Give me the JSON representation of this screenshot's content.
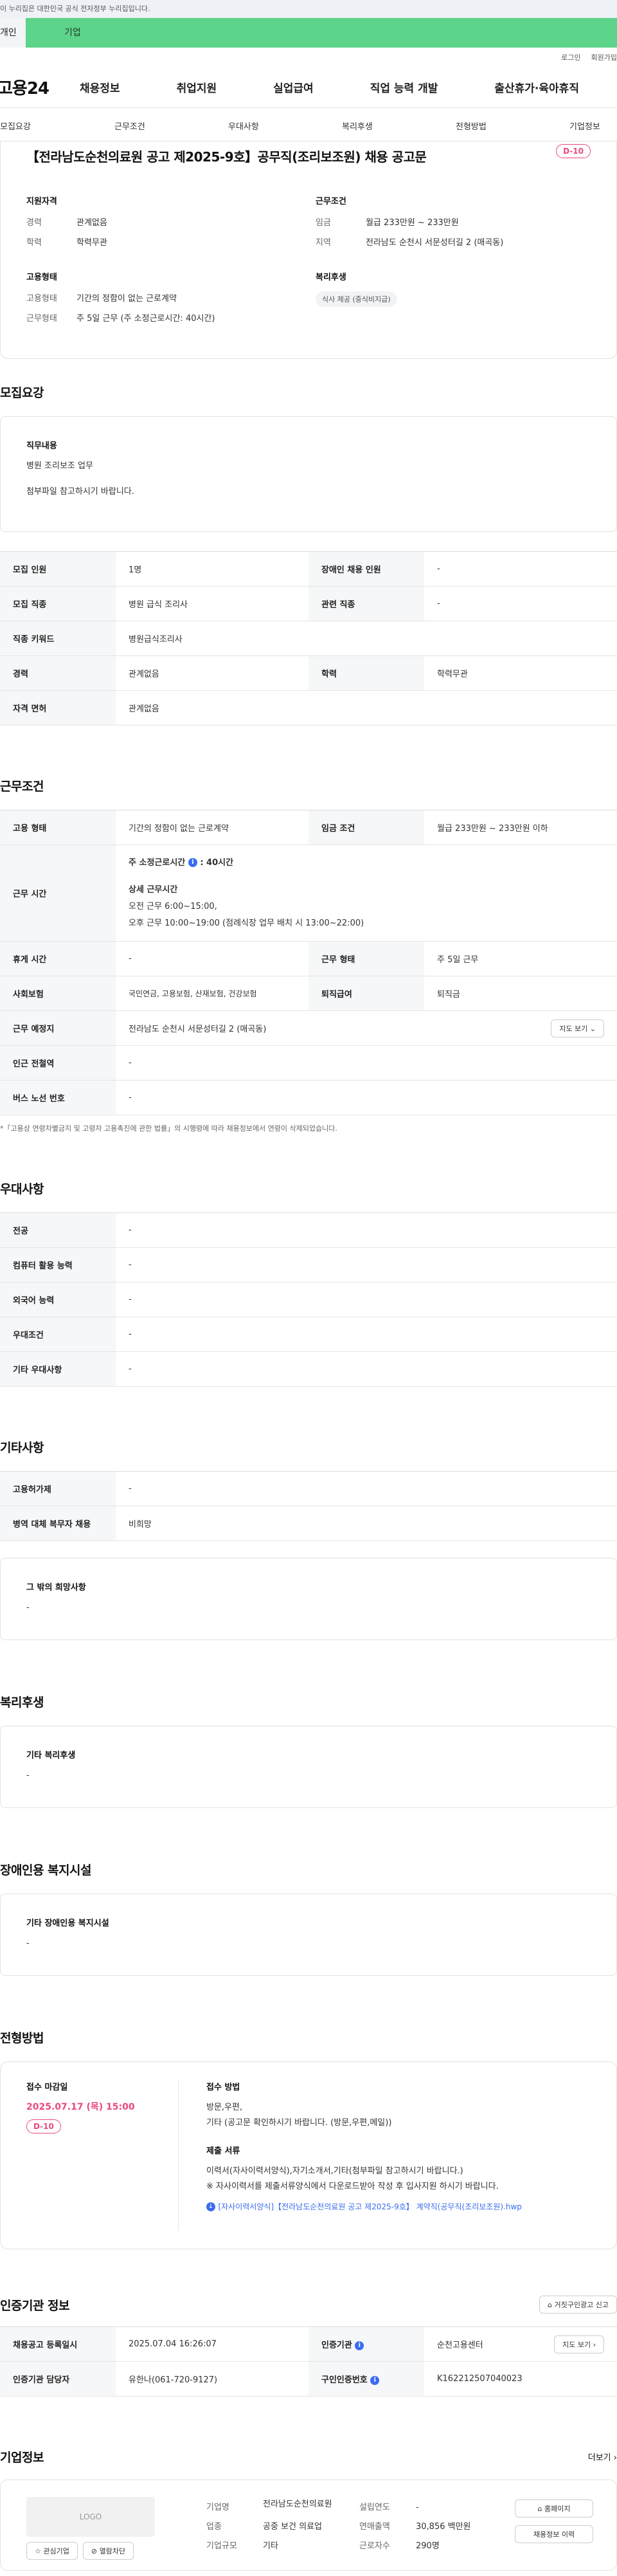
{
  "gov_banner": "이 누리집은 대한민국 공식 전자정부 누리집입니다.",
  "tabs": {
    "individual": "개인",
    "business": "기업"
  },
  "util": {
    "login": "로그인",
    "join": "회원가입"
  },
  "logo": "고용24",
  "gnb": [
    "채용정보",
    "취업지원",
    "실업급여",
    "직업 능력 개발",
    "출산휴가·육아휴직"
  ],
  "subnav": [
    "모집요강",
    "근무조건",
    "우대사항",
    "복리후생",
    "전형방법",
    "기업정보"
  ],
  "job": {
    "title": "【전라남도순천의료원 공고 제2025-9호】공무직(조리보조원) 채용 공고문",
    "dday": "D-10",
    "qual_h": "지원자격",
    "qual": [
      {
        "k": "경력",
        "v": "관계없음"
      },
      {
        "k": "학력",
        "v": "학력무관"
      }
    ],
    "emp_h": "고용형태",
    "emp": [
      {
        "k": "고용형태",
        "v": "기간의 정함이 없는 근로계약"
      },
      {
        "k": "근무형태",
        "v": "주 5일 근무 (주 소정근로시간: 40시간)"
      }
    ],
    "cond_h": "근무조건",
    "cond": [
      {
        "k": "임금",
        "v": "월급 233만원 ~ 233만원"
      },
      {
        "k": "지역",
        "v": "전라남도 순천시 서문성터길 2 (매곡동)"
      }
    ],
    "welfare_h": "복리후생",
    "welfare_chip": "식사 제공 (중식비지급)"
  },
  "recruit": {
    "title": "모집요강",
    "duty_h": "직무내용",
    "duty_lines": [
      "병원 조리보조 업무",
      "첨부파일 참고하시기 바랍니다."
    ],
    "rows": [
      {
        "k1": "모집 인원",
        "v1": "1명",
        "k2": "장애인 채용 인원",
        "v2": "-"
      },
      {
        "k1": "모집 직종",
        "v1": "병원 급식 조리사",
        "k2": "관련 직종",
        "v2": "-"
      }
    ],
    "keyword_k": "직종 키워드",
    "keyword_v": "병원급식조리사",
    "career": {
      "k1": "경력",
      "v1": "관계없음",
      "k2": "학력",
      "v2": "학력무관"
    },
    "license_k": "자격 면허",
    "license_v": "관계없음"
  },
  "work": {
    "title": "근무조건",
    "type_k": "고용 형태",
    "type_v": "기간의 정함이 없는 근로계약",
    "wage_k": "임금 조건",
    "wage_v": "월급 233만원 ~ 233만원 이하",
    "hours_k": "근무 시간",
    "hours_main": "주 소정근로시간",
    "hours_main_val": ": 40시간",
    "hours_detail_h": "상세 근무시간",
    "hours_detail": [
      "오전 근무 6:00~15:00,",
      "오후 근무 10:00~19:00 (점례식장 업무 배치 시 13:00~22:00)"
    ],
    "break_k": "휴게 시간",
    "break_v": "-",
    "form_k": "근무 형태",
    "form_v": "주 5일 근무",
    "ins_k": "사회보험",
    "ins_v": "국민연금, 고용보험, 산재보험, 건강보험",
    "sev_k": "퇴직급여",
    "sev_v": "퇴직금",
    "place_k": "근무 예정지",
    "place_v": "전라남도 순천시 서문성터길 2 (매곡동)",
    "map_btn": "지도 보기",
    "station_k": "인근 전철역",
    "station_v": "-",
    "bus_k": "버스 노선 번호",
    "bus_v": "-",
    "note": "*「고용상 연령차별금지 및 고령자 고용촉진에 관한 법률」의 시행령에 따라 채용정보에서 연령이 삭제되었습니다."
  },
  "pref": {
    "title": "우대사항",
    "rows": [
      {
        "k": "전공",
        "v": "-"
      },
      {
        "k": "컴퓨터 활용 능력",
        "v": "-"
      },
      {
        "k": "외국어 능력",
        "v": "-"
      },
      {
        "k": "우대조건",
        "v": "-"
      },
      {
        "k": "기타 우대사항",
        "v": "-"
      }
    ]
  },
  "etc": {
    "title": "기타사항",
    "rows": [
      {
        "k": "고용허가제",
        "v": "-"
      },
      {
        "k": "병역 대체 복무자 채용",
        "v": "비희망"
      }
    ],
    "other_h": "그 밖의 희망사항",
    "other_v": "-"
  },
  "welfare": {
    "title": "복리후생",
    "h": "기타 복리후생",
    "v": "-"
  },
  "disabled": {
    "title": "장애인용 복지시설",
    "h": "기타 장애인용 복지시설",
    "v": "-"
  },
  "process": {
    "title": "전형방법",
    "deadline_h": "접수 마감일",
    "deadline": "2025.07.17 (목) 15:00",
    "dday": "D-10",
    "method_h": "접수 방법",
    "method_lines": [
      "방문,우편,",
      "기타 (공고문 확인하시기 바랍니다. (방문,우편,메일))"
    ],
    "docs_h": "제출 서류",
    "docs_lines": [
      "이력서(자사이력서양식),자기소개서,기타(첨부파일 참고하시기 바랍니다.)",
      "※ 자사이력서를 제출서류양식에서 다운로드받아 작성 후 입사지원 하시기 바랍니다."
    ],
    "file": "[자사이력서양식]【전라남도순천의료원 공고 제2025-9호】 계약직(공무직(조리보조원).hwp"
  },
  "cert": {
    "title": "인증기관 정보",
    "report_btn": "거짓구인광고 신고",
    "rows": [
      {
        "k1": "채용공고 등록일시",
        "v1": "2025.07.04 16:26:07",
        "k2": "인증기관",
        "v2": "순천고용센터",
        "btn": "지도 보기"
      },
      {
        "k1": "인증기관 담당자",
        "v1": "유한나(061-720-9127)",
        "k2": "구인인증번호",
        "v2": "K162212507040023",
        "btn": ""
      }
    ]
  },
  "company": {
    "title": "기업정보",
    "more": "더보기",
    "logo_ph": "LOGO",
    "fav_btn": "관심기업",
    "block_btn": "열람차단",
    "name_k": "기업명",
    "name_v": "전라남도순천의료원",
    "ind_k": "업종",
    "ind_v": "공중 보건 의료업",
    "size_k": "기업규모",
    "size_v": "기타",
    "est_k": "설립연도",
    "est_v": "-",
    "sales_k": "연매출액",
    "sales_v": "30,856 백만원",
    "emp_k": "근로자수",
    "emp_v": "290명",
    "home_btn": "홈페이지",
    "hist_btn": "채용정보 이력"
  }
}
